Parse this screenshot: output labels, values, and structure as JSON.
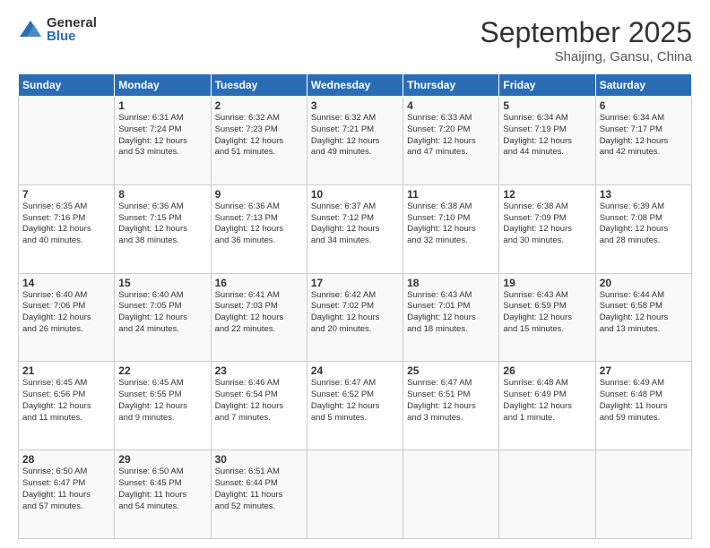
{
  "logo": {
    "general": "General",
    "blue": "Blue"
  },
  "title": "September 2025",
  "subtitle": "Shaijing, Gansu, China",
  "days_header": [
    "Sunday",
    "Monday",
    "Tuesday",
    "Wednesday",
    "Thursday",
    "Friday",
    "Saturday"
  ],
  "weeks": [
    [
      {
        "day": "",
        "info": ""
      },
      {
        "day": "1",
        "info": "Sunrise: 6:31 AM\nSunset: 7:24 PM\nDaylight: 12 hours\nand 53 minutes."
      },
      {
        "day": "2",
        "info": "Sunrise: 6:32 AM\nSunset: 7:23 PM\nDaylight: 12 hours\nand 51 minutes."
      },
      {
        "day": "3",
        "info": "Sunrise: 6:32 AM\nSunset: 7:21 PM\nDaylight: 12 hours\nand 49 minutes."
      },
      {
        "day": "4",
        "info": "Sunrise: 6:33 AM\nSunset: 7:20 PM\nDaylight: 12 hours\nand 47 minutes."
      },
      {
        "day": "5",
        "info": "Sunrise: 6:34 AM\nSunset: 7:19 PM\nDaylight: 12 hours\nand 44 minutes."
      },
      {
        "day": "6",
        "info": "Sunrise: 6:34 AM\nSunset: 7:17 PM\nDaylight: 12 hours\nand 42 minutes."
      }
    ],
    [
      {
        "day": "7",
        "info": "Sunrise: 6:35 AM\nSunset: 7:16 PM\nDaylight: 12 hours\nand 40 minutes."
      },
      {
        "day": "8",
        "info": "Sunrise: 6:36 AM\nSunset: 7:15 PM\nDaylight: 12 hours\nand 38 minutes."
      },
      {
        "day": "9",
        "info": "Sunrise: 6:36 AM\nSunset: 7:13 PM\nDaylight: 12 hours\nand 36 minutes."
      },
      {
        "day": "10",
        "info": "Sunrise: 6:37 AM\nSunset: 7:12 PM\nDaylight: 12 hours\nand 34 minutes."
      },
      {
        "day": "11",
        "info": "Sunrise: 6:38 AM\nSunset: 7:10 PM\nDaylight: 12 hours\nand 32 minutes."
      },
      {
        "day": "12",
        "info": "Sunrise: 6:38 AM\nSunset: 7:09 PM\nDaylight: 12 hours\nand 30 minutes."
      },
      {
        "day": "13",
        "info": "Sunrise: 6:39 AM\nSunset: 7:08 PM\nDaylight: 12 hours\nand 28 minutes."
      }
    ],
    [
      {
        "day": "14",
        "info": "Sunrise: 6:40 AM\nSunset: 7:06 PM\nDaylight: 12 hours\nand 26 minutes."
      },
      {
        "day": "15",
        "info": "Sunrise: 6:40 AM\nSunset: 7:05 PM\nDaylight: 12 hours\nand 24 minutes."
      },
      {
        "day": "16",
        "info": "Sunrise: 6:41 AM\nSunset: 7:03 PM\nDaylight: 12 hours\nand 22 minutes."
      },
      {
        "day": "17",
        "info": "Sunrise: 6:42 AM\nSunset: 7:02 PM\nDaylight: 12 hours\nand 20 minutes."
      },
      {
        "day": "18",
        "info": "Sunrise: 6:43 AM\nSunset: 7:01 PM\nDaylight: 12 hours\nand 18 minutes."
      },
      {
        "day": "19",
        "info": "Sunrise: 6:43 AM\nSunset: 6:59 PM\nDaylight: 12 hours\nand 15 minutes."
      },
      {
        "day": "20",
        "info": "Sunrise: 6:44 AM\nSunset: 6:58 PM\nDaylight: 12 hours\nand 13 minutes."
      }
    ],
    [
      {
        "day": "21",
        "info": "Sunrise: 6:45 AM\nSunset: 6:56 PM\nDaylight: 12 hours\nand 11 minutes."
      },
      {
        "day": "22",
        "info": "Sunrise: 6:45 AM\nSunset: 6:55 PM\nDaylight: 12 hours\nand 9 minutes."
      },
      {
        "day": "23",
        "info": "Sunrise: 6:46 AM\nSunset: 6:54 PM\nDaylight: 12 hours\nand 7 minutes."
      },
      {
        "day": "24",
        "info": "Sunrise: 6:47 AM\nSunset: 6:52 PM\nDaylight: 12 hours\nand 5 minutes."
      },
      {
        "day": "25",
        "info": "Sunrise: 6:47 AM\nSunset: 6:51 PM\nDaylight: 12 hours\nand 3 minutes."
      },
      {
        "day": "26",
        "info": "Sunrise: 6:48 AM\nSunset: 6:49 PM\nDaylight: 12 hours\nand 1 minute."
      },
      {
        "day": "27",
        "info": "Sunrise: 6:49 AM\nSunset: 6:48 PM\nDaylight: 11 hours\nand 59 minutes."
      }
    ],
    [
      {
        "day": "28",
        "info": "Sunrise: 6:50 AM\nSunset: 6:47 PM\nDaylight: 11 hours\nand 57 minutes."
      },
      {
        "day": "29",
        "info": "Sunrise: 6:50 AM\nSunset: 6:45 PM\nDaylight: 11 hours\nand 54 minutes."
      },
      {
        "day": "30",
        "info": "Sunrise: 6:51 AM\nSunset: 6:44 PM\nDaylight: 11 hours\nand 52 minutes."
      },
      {
        "day": "",
        "info": ""
      },
      {
        "day": "",
        "info": ""
      },
      {
        "day": "",
        "info": ""
      },
      {
        "day": "",
        "info": ""
      }
    ]
  ]
}
